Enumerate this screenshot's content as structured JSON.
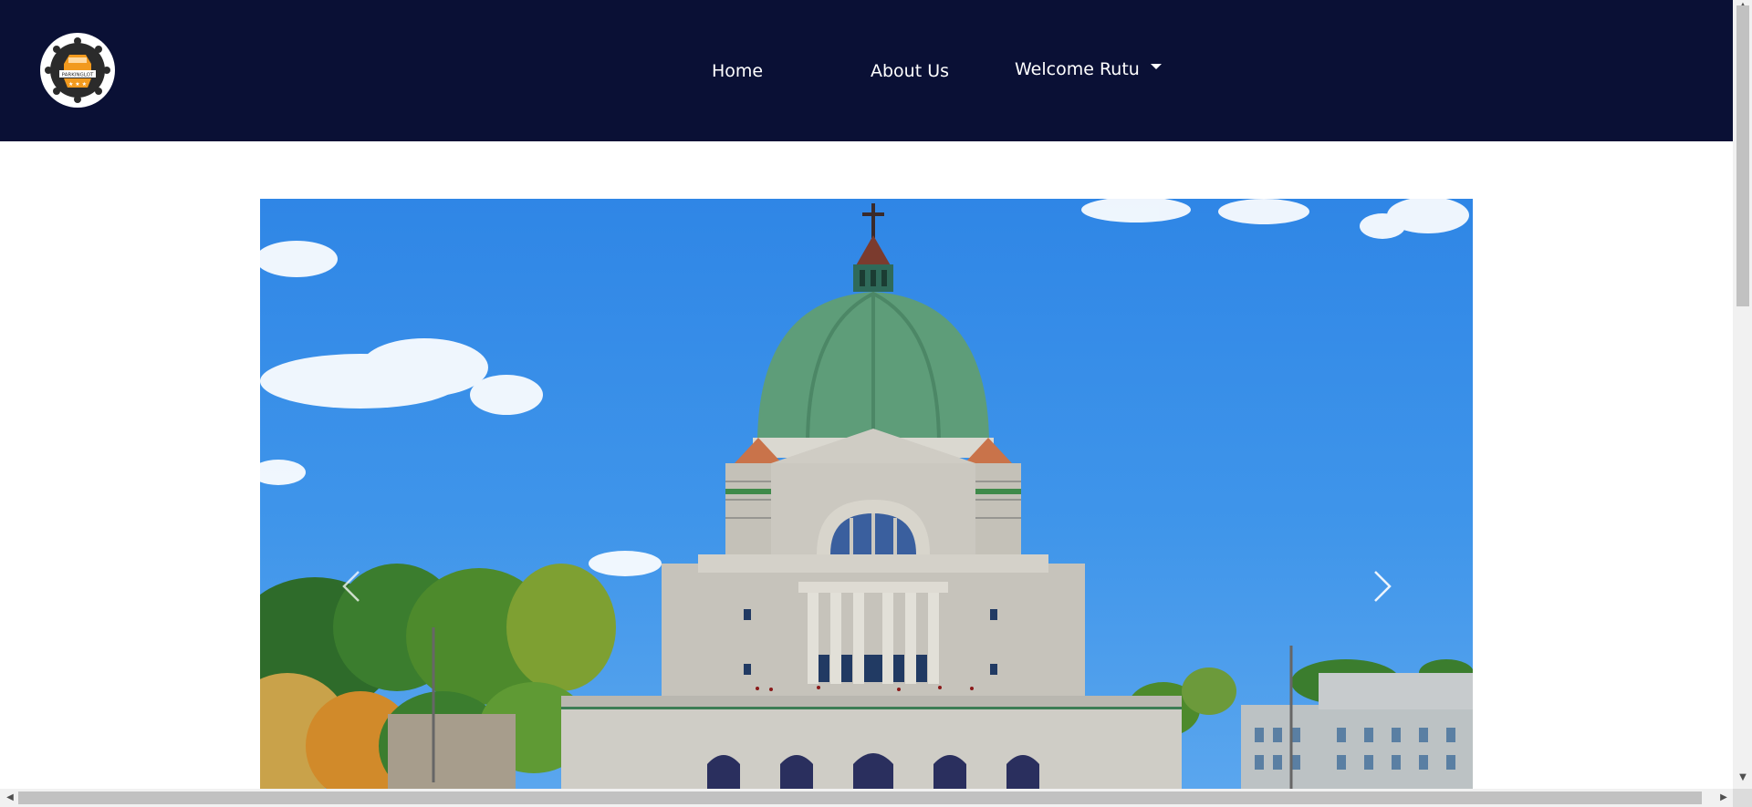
{
  "header": {
    "logo_text": "PARKINGLOT",
    "nav": {
      "home": "Home",
      "about": "About Us",
      "welcome": "Welcome Rutu"
    }
  },
  "carousel": {
    "prev_icon": "chevron-left-icon",
    "next_icon": "chevron-right-icon"
  },
  "colors": {
    "navbar": "#0a1035",
    "sky": "#3f95ea",
    "dome": "#5e9d79",
    "stone": "#c9c7c0"
  }
}
